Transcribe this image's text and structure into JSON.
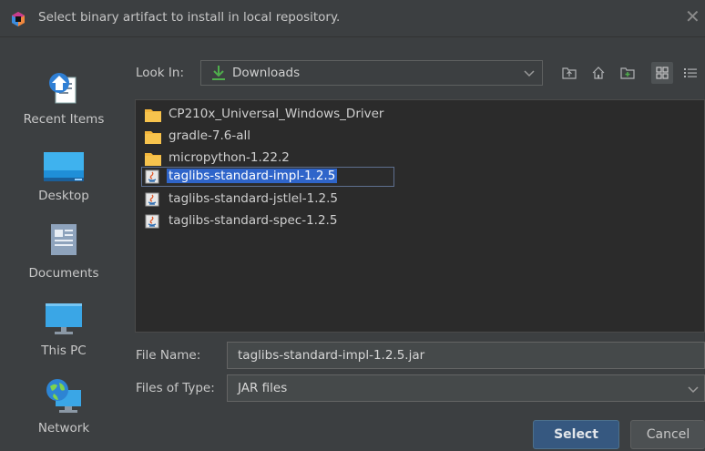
{
  "window": {
    "title": "Select binary artifact to install in local repository.",
    "close_icon": "close-icon",
    "app_icon": "intellij-app-icon"
  },
  "places": [
    {
      "label": "Recent Items",
      "icon": "recent-items-icon"
    },
    {
      "label": "Desktop",
      "icon": "desktop-icon"
    },
    {
      "label": "Documents",
      "icon": "documents-icon"
    },
    {
      "label": "This PC",
      "icon": "monitor-icon"
    },
    {
      "label": "Network",
      "icon": "network-globe-icon"
    }
  ],
  "lookin": {
    "label": "Look In:",
    "value": "Downloads",
    "icon": "download-arrow-icon"
  },
  "toolbar": {
    "icons": [
      "up-folder-icon",
      "home-icon",
      "new-folder-icon",
      "list-view-icon",
      "details-view-icon"
    ],
    "active": "list-view-icon"
  },
  "files": [
    {
      "name": "CP210x_Universal_Windows_Driver",
      "type": "folder",
      "selected": false
    },
    {
      "name": "gradle-7.6-all",
      "type": "folder",
      "selected": false
    },
    {
      "name": "micropython-1.22.2",
      "type": "folder",
      "selected": false
    },
    {
      "name": "taglibs-standard-impl-1.2.5",
      "type": "jar",
      "selected": true
    },
    {
      "name": "taglibs-standard-jstlel-1.2.5",
      "type": "jar",
      "selected": false
    },
    {
      "name": "taglibs-standard-spec-1.2.5",
      "type": "jar",
      "selected": false
    }
  ],
  "filename": {
    "label": "File Name:",
    "value": "taglibs-standard-impl-1.2.5.jar"
  },
  "filetype": {
    "label": "Files of Type:",
    "value": "JAR files"
  },
  "buttons": {
    "select": "Select",
    "cancel": "Cancel"
  },
  "colors": {
    "background": "#3c3f41",
    "list_background": "#2b2b2b",
    "selection": "#2f65ca",
    "folder": "#f4b63b",
    "primary_button": "#365880",
    "accent_green": "#4fae4c"
  }
}
